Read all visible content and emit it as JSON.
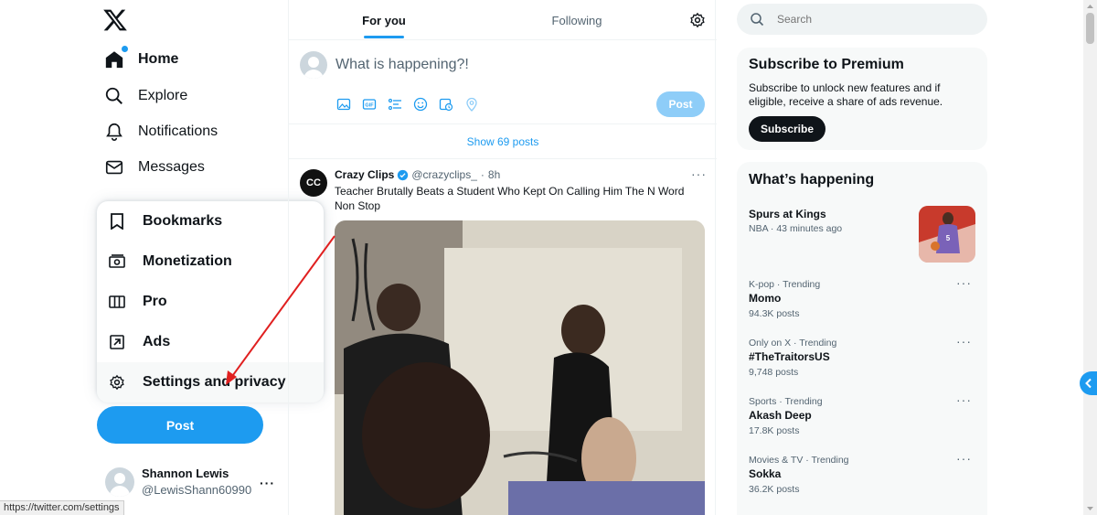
{
  "nav": {
    "logo": "x-logo-icon",
    "items": [
      {
        "label": "Home",
        "icon": "home-icon",
        "active": true
      },
      {
        "label": "Explore",
        "icon": "search-icon"
      },
      {
        "label": "Notifications",
        "icon": "bell-icon"
      },
      {
        "label": "Messages",
        "icon": "mail-icon"
      }
    ],
    "more_menu": [
      {
        "label": "Bookmarks",
        "icon": "bookmark-icon"
      },
      {
        "label": "Monetization",
        "icon": "money-icon"
      },
      {
        "label": "Pro",
        "icon": "columns-icon"
      },
      {
        "label": "Ads",
        "icon": "external-arrow-icon"
      },
      {
        "label": "Settings and privacy",
        "icon": "gear-icon"
      }
    ],
    "post_button": "Post",
    "account": {
      "name": "Shannon Lewis",
      "handle": "@LewisShann60990",
      "more": "···"
    }
  },
  "status_url": "https://twitter.com/settings",
  "timeline": {
    "tabs": [
      {
        "label": "For you",
        "active": true
      },
      {
        "label": "Following"
      }
    ],
    "composer": {
      "placeholder": "What is happening?!",
      "post_label": "Post"
    },
    "show_posts": "Show 69 posts",
    "tweet": {
      "avatar_text": "CC",
      "name": "Crazy Clips",
      "handle": "@crazyclips_",
      "time": "8h",
      "separator": "·",
      "more": "···",
      "text": "Teacher Brutally Beats a Student Who Kept On Calling Him The N Word Non Stop"
    }
  },
  "sidebar": {
    "search_placeholder": "Search",
    "premium": {
      "title": "Subscribe to Premium",
      "description": "Subscribe to unlock new features and if eligible, receive a share of ads revenue.",
      "button": "Subscribe"
    },
    "happening": {
      "title": "What’s happening",
      "trends": [
        {
          "category": "Spurs at Kings",
          "name": "",
          "sub": "NBA · 43 minutes ago",
          "has_image": true
        },
        {
          "category": "K-pop · Trending",
          "name": "Momo",
          "sub": "94.3K posts"
        },
        {
          "category": "Only on X · Trending",
          "name": "#TheTraitorsUS",
          "sub": "9,748 posts"
        },
        {
          "category": "Sports · Trending",
          "name": "Akash Deep",
          "sub": "17.8K posts"
        },
        {
          "category": "Movies & TV · Trending",
          "name": "Sokka",
          "sub": "36.2K posts"
        }
      ]
    }
  },
  "colors": {
    "accent": "#1d9bf0",
    "text": "#0f1419",
    "muted": "#536471",
    "annotation": "#e02020"
  }
}
